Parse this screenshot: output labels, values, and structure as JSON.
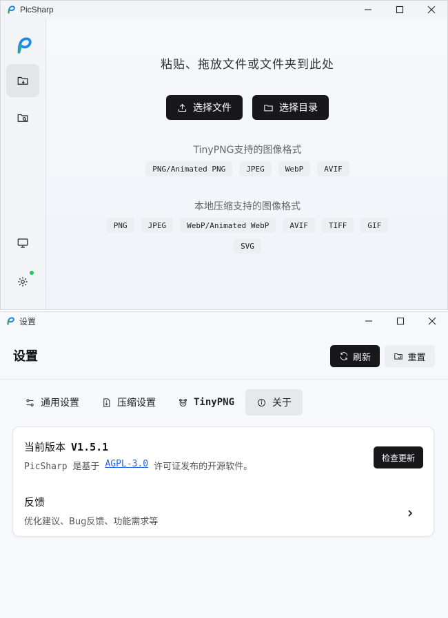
{
  "main_window": {
    "title": "PicSharp",
    "drop_title": "粘贴、拖放文件或文件夹到此处",
    "buttons": {
      "select_files": "选择文件",
      "select_folder": "选择目录"
    },
    "tinypng": {
      "title": "TinyPNG支持的图像格式",
      "formats": [
        "PNG/Animated PNG",
        "JPEG",
        "WebP",
        "AVIF"
      ]
    },
    "local": {
      "title": "本地压缩支持的图像格式",
      "formats": [
        "PNG",
        "JPEG",
        "WebP/Animated WebP",
        "AVIF",
        "TIFF",
        "GIF",
        "SVG"
      ]
    },
    "sidebar": {
      "status_dot_color": "#22c55e"
    }
  },
  "settings_window": {
    "title": "设置",
    "header": {
      "title": "设置",
      "refresh_label": "刷新",
      "reset_label": "重置"
    },
    "tabs": [
      {
        "label": "通用设置",
        "icon": "sliders-icon"
      },
      {
        "label": "压缩设置",
        "icon": "file-zip-icon"
      },
      {
        "label": "TinyPNG",
        "icon": "panda-icon"
      },
      {
        "label": "关于",
        "icon": "info-icon"
      }
    ],
    "about": {
      "version_label": "当前版本",
      "version": "V1.5.1",
      "license_prefix": "PicSharp 是基于",
      "license_link": "AGPL-3.0",
      "license_suffix": "许可证发布的开源软件。",
      "check_update_label": "检查更新",
      "feedback_title": "反馈",
      "feedback_sub": "优化建议、Bug反馈、功能需求等"
    }
  }
}
